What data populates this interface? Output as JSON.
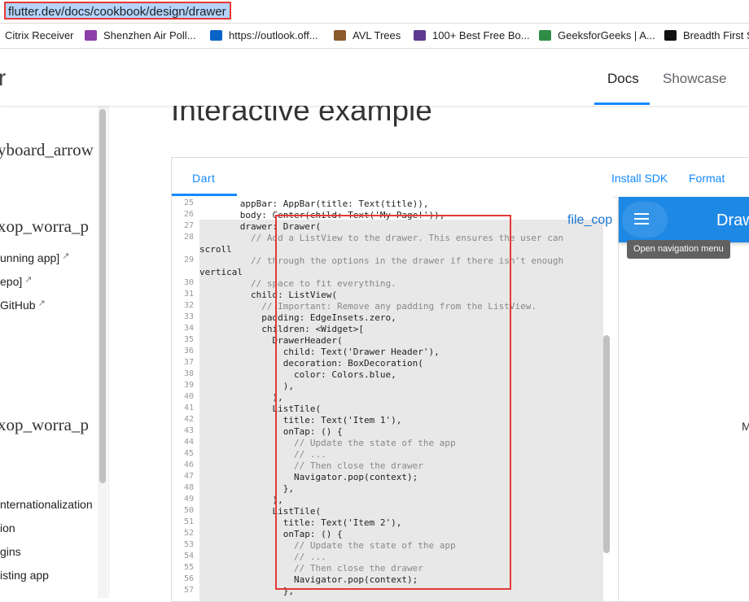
{
  "browser": {
    "url": "flutter.dev/docs/cookbook/design/drawer",
    "bookmarks": [
      {
        "label": "Citrix Receiver",
        "icon": "none",
        "color": ""
      },
      {
        "label": "Shenzhen Air Poll...",
        "icon": "aqi-icon",
        "color": "#8b3fa8"
      },
      {
        "label": "https://outlook.off...",
        "icon": "outlook-icon",
        "color": "#0a64c8"
      },
      {
        "label": "AVL Trees",
        "icon": "tree-icon",
        "color": "#8a5a2b"
      },
      {
        "label": "100+ Best Free Bo...",
        "icon": "colorlib-icon",
        "color": "#5b3a8f"
      },
      {
        "label": "GeeksforGeeks | A...",
        "icon": "geeks-icon",
        "color": "#2f8d46"
      },
      {
        "label": "Breadth First S",
        "icon": "clock-icon",
        "color": "#111111"
      }
    ]
  },
  "header": {
    "logo_fragment": "r",
    "nav": {
      "docs": "Docs",
      "showcase": "Showcase"
    },
    "accent": "#1389fd"
  },
  "sidebar": {
    "ligatures": [
      "yboard_arrow",
      "xop_worra_p",
      "xop_worra_p"
    ],
    "links": [
      {
        "label": "unning app]",
        "external": true
      },
      {
        "label": "epo]",
        "external": true
      },
      {
        "label": "GitHub",
        "external": true
      },
      {
        "label": "nternationalization",
        "external": false
      },
      {
        "label": "ion",
        "external": false
      },
      {
        "label": "gins",
        "external": false
      },
      {
        "label": "isting app",
        "external": false
      }
    ]
  },
  "main": {
    "heading": "Interactive example",
    "dartpad": {
      "tab": "Dart",
      "actions": {
        "install": "Install SDK",
        "format": "Format"
      },
      "copy_icon_text": "file_cop",
      "code": [
        {
          "n": "25",
          "t": "      appBar: AppBar(title: Text(title)),"
        },
        {
          "n": "26",
          "t": "      body: Center(child: Text('My Page!')),"
        },
        {
          "n": "27",
          "t": "      drawer: Drawer("
        },
        {
          "n": "28",
          "t": "        // Add a ListView to the drawer. This ensures the user can"
        },
        {
          "n": "",
          "t": "scroll"
        },
        {
          "n": "29",
          "t": "        // through the options in the drawer if there isn't enough"
        },
        {
          "n": "",
          "t": "vertical"
        },
        {
          "n": "30",
          "t": "        // space to fit everything."
        },
        {
          "n": "31",
          "t": "        child: ListView("
        },
        {
          "n": "32",
          "t": "          // Important: Remove any padding from the ListView."
        },
        {
          "n": "33",
          "t": "          padding: EdgeInsets.zero,"
        },
        {
          "n": "34",
          "t": "          children: <Widget>["
        },
        {
          "n": "35",
          "t": "            DrawerHeader("
        },
        {
          "n": "36",
          "t": "              child: Text('Drawer Header'),"
        },
        {
          "n": "37",
          "t": "              decoration: BoxDecoration("
        },
        {
          "n": "38",
          "t": "                color: Colors.blue,"
        },
        {
          "n": "39",
          "t": "              ),"
        },
        {
          "n": "40",
          "t": "            ),"
        },
        {
          "n": "41",
          "t": "            ListTile("
        },
        {
          "n": "42",
          "t": "              title: Text('Item 1'),"
        },
        {
          "n": "43",
          "t": "              onTap: () {"
        },
        {
          "n": "44",
          "t": "                // Update the state of the app"
        },
        {
          "n": "45",
          "t": "                // ..."
        },
        {
          "n": "46",
          "t": "                // Then close the drawer"
        },
        {
          "n": "47",
          "t": "                Navigator.pop(context);"
        },
        {
          "n": "48",
          "t": "              },"
        },
        {
          "n": "49",
          "t": "            ),"
        },
        {
          "n": "50",
          "t": "            ListTile("
        },
        {
          "n": "51",
          "t": "              title: Text('Item 2'),"
        },
        {
          "n": "52",
          "t": "              onTap: () {"
        },
        {
          "n": "53",
          "t": "                // Update the state of the app"
        },
        {
          "n": "54",
          "t": "                // ..."
        },
        {
          "n": "55",
          "t": "                // Then close the drawer"
        },
        {
          "n": "56",
          "t": "                Navigator.pop(context);"
        },
        {
          "n": "57",
          "t": "              },"
        }
      ],
      "preview": {
        "appbar_title": "Draw",
        "tooltip": "Open navigation menu",
        "body_fragment": "M",
        "appbar_color": "#1e88e5"
      }
    }
  },
  "annotation_color": "#e53935"
}
